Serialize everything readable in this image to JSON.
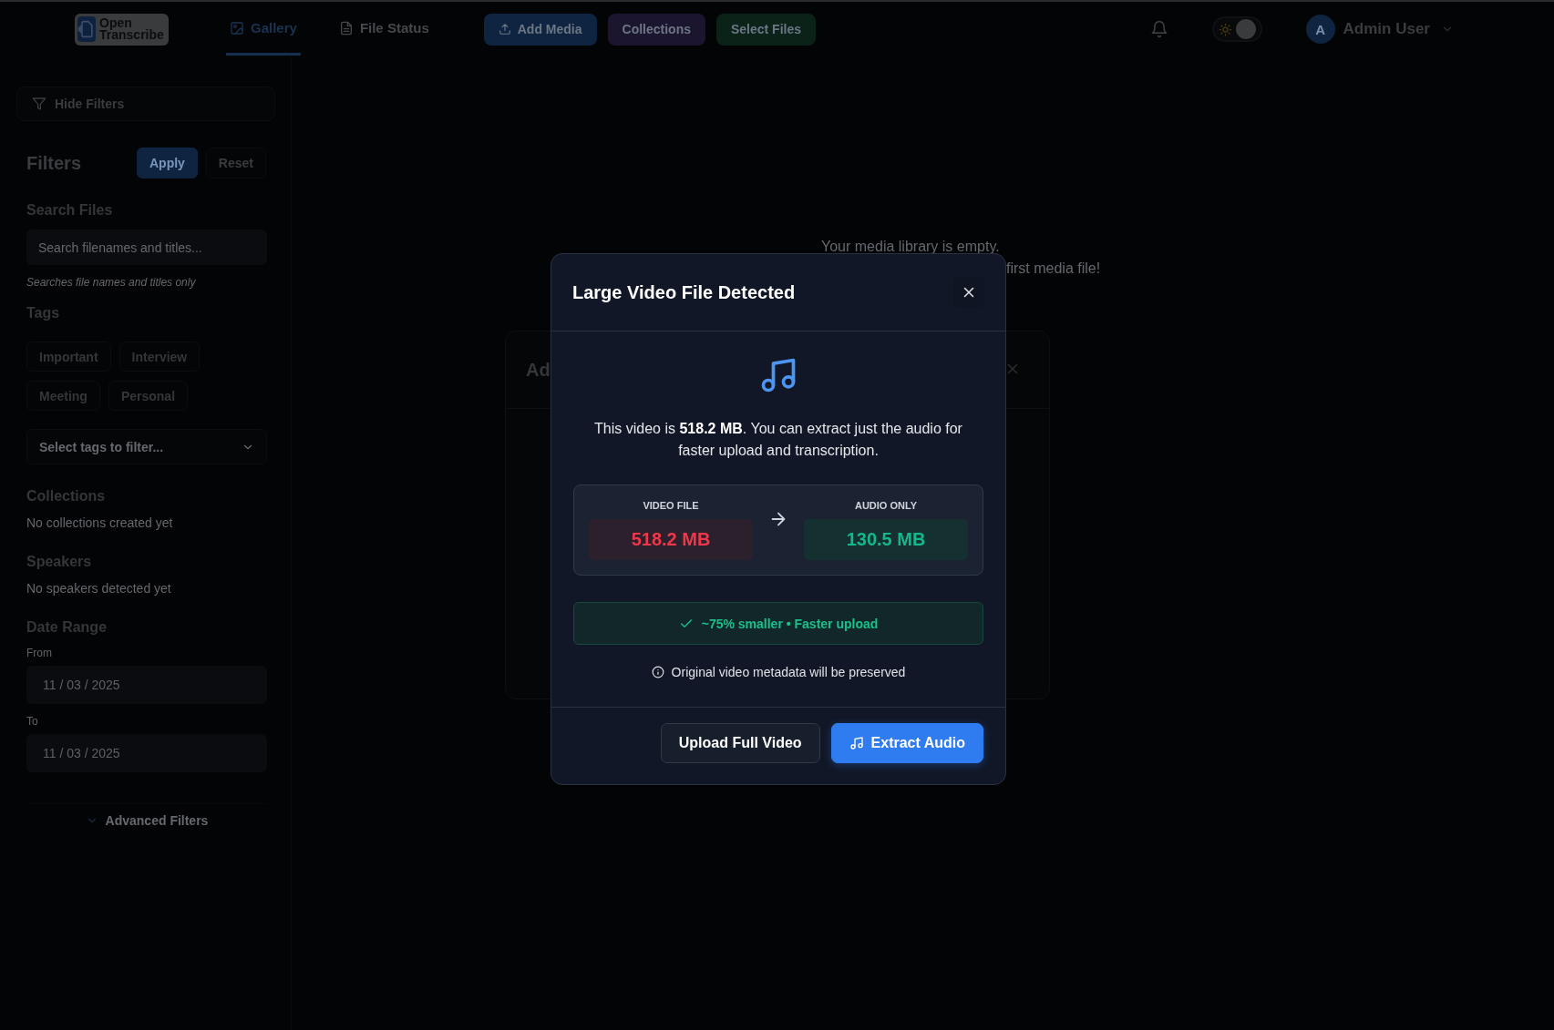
{
  "header": {
    "logo_lines": [
      "Open",
      "Transcribe"
    ],
    "nav_tabs": [
      {
        "label": "Gallery",
        "kind": "image",
        "selected": true
      },
      {
        "label": "File Status",
        "kind": "file",
        "selected": false
      }
    ],
    "actions": [
      {
        "label": "Add Media",
        "kind": "upload",
        "color": "#0f2440"
      },
      {
        "label": "Collections",
        "kind": "plain",
        "color": "#1c1530"
      },
      {
        "label": "Select Files",
        "kind": "plain",
        "color": "#0a2218"
      }
    ],
    "theme_toggle": {
      "on": true
    },
    "user": {
      "initial": "A",
      "name": "Admin User"
    }
  },
  "sidebar": {
    "hide_filters": "Hide Filters",
    "title": "Filters",
    "apply": "Apply",
    "reset": "Reset",
    "search": {
      "label": "Search Files",
      "placeholder": "Search filenames and titles...",
      "hint": "Searches file names and titles only"
    },
    "tags": {
      "label": "Tags",
      "items": [
        [
          "Important",
          "Interview"
        ],
        [
          "Meeting",
          "Personal"
        ]
      ],
      "select_placeholder": "Select tags to filter..."
    },
    "collections": {
      "label": "Collections",
      "empty": "No collections created yet"
    },
    "speakers": {
      "label": "Speakers",
      "empty": "No speakers detected yet"
    },
    "date_range": {
      "label": "Date Range",
      "fields": [
        {
          "label": "From",
          "value": "11 / 03 / 2025"
        },
        {
          "label": "To",
          "value": "11 / 03 / 2025"
        }
      ]
    },
    "advanced": "Advanced Filters"
  },
  "main": {
    "empty_lines": [
      "Your media library is empty.",
      "first media file!"
    ],
    "back_dialog": {
      "title": "Ad"
    }
  },
  "modal": {
    "title": "Large Video File Detected",
    "message": "This video is **518.2 MB**. You can extract just the audio for faster upload and transcription.",
    "sizes": [
      {
        "kind": "before",
        "label": "VIDEO FILE",
        "value": "518.2 MB"
      },
      {
        "kind": "after",
        "label": "AUDIO ONLY",
        "value": "130.5 MB"
      }
    ],
    "savings": "~75% smaller • Faster upload",
    "note": "Original video metadata will be preserved",
    "buttons": [
      {
        "label": "Upload Full Video",
        "kind": "secondary"
      },
      {
        "label": "Extract Audio",
        "kind": "primary"
      }
    ]
  }
}
